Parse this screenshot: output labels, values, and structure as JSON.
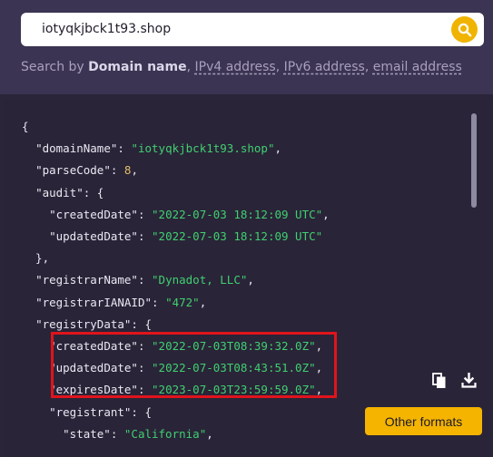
{
  "search": {
    "value": "iotyqkjbck1t93.shop"
  },
  "hint": {
    "prefix": "Search by ",
    "domain_name": "Domain name",
    "sep1": ", ",
    "ipv4": "IPv4 address",
    "sep2": ", ",
    "ipv6": "IPv6 address",
    "sep3": ", ",
    "email": "email address"
  },
  "code_lines": [
    [
      {
        "t": "p",
        "v": "{"
      }
    ],
    [
      {
        "t": "p",
        "v": "  "
      },
      {
        "t": "k",
        "v": "\"domainName\""
      },
      {
        "t": "p",
        "v": ": "
      },
      {
        "t": "s",
        "v": "\"iotyqkjbck1t93.shop\""
      },
      {
        "t": "p",
        "v": ","
      }
    ],
    [
      {
        "t": "p",
        "v": "  "
      },
      {
        "t": "k",
        "v": "\"parseCode\""
      },
      {
        "t": "p",
        "v": ": "
      },
      {
        "t": "n",
        "v": "8"
      },
      {
        "t": "p",
        "v": ","
      }
    ],
    [
      {
        "t": "p",
        "v": "  "
      },
      {
        "t": "k",
        "v": "\"audit\""
      },
      {
        "t": "p",
        "v": ": {"
      }
    ],
    [
      {
        "t": "p",
        "v": "    "
      },
      {
        "t": "k",
        "v": "\"createdDate\""
      },
      {
        "t": "p",
        "v": ": "
      },
      {
        "t": "s",
        "v": "\"2022-07-03 18:12:09 UTC\""
      },
      {
        "t": "p",
        "v": ","
      }
    ],
    [
      {
        "t": "p",
        "v": "    "
      },
      {
        "t": "k",
        "v": "\"updatedDate\""
      },
      {
        "t": "p",
        "v": ": "
      },
      {
        "t": "s",
        "v": "\"2022-07-03 18:12:09 UTC\""
      }
    ],
    [
      {
        "t": "p",
        "v": "  },"
      }
    ],
    [
      {
        "t": "p",
        "v": "  "
      },
      {
        "t": "k",
        "v": "\"registrarName\""
      },
      {
        "t": "p",
        "v": ": "
      },
      {
        "t": "s",
        "v": "\"Dynadot, LLC\""
      },
      {
        "t": "p",
        "v": ","
      }
    ],
    [
      {
        "t": "p",
        "v": "  "
      },
      {
        "t": "k",
        "v": "\"registrarIANAID\""
      },
      {
        "t": "p",
        "v": ": "
      },
      {
        "t": "s",
        "v": "\"472\""
      },
      {
        "t": "p",
        "v": ","
      }
    ],
    [
      {
        "t": "p",
        "v": "  "
      },
      {
        "t": "k",
        "v": "\"registryData\""
      },
      {
        "t": "p",
        "v": ": {"
      }
    ],
    [
      {
        "t": "p",
        "v": "    "
      },
      {
        "t": "k",
        "v": "\"createdDate\""
      },
      {
        "t": "p",
        "v": ": "
      },
      {
        "t": "s",
        "v": "\"2022-07-03T08:39:32.0Z\""
      },
      {
        "t": "p",
        "v": ","
      }
    ],
    [
      {
        "t": "p",
        "v": "    "
      },
      {
        "t": "k",
        "v": "\"updatedDate\""
      },
      {
        "t": "p",
        "v": ": "
      },
      {
        "t": "s",
        "v": "\"2022-07-03T08:43:51.0Z\""
      },
      {
        "t": "p",
        "v": ","
      }
    ],
    [
      {
        "t": "p",
        "v": "    "
      },
      {
        "t": "k",
        "v": "\"expiresDate\""
      },
      {
        "t": "p",
        "v": ": "
      },
      {
        "t": "s",
        "v": "\"2023-07-03T23:59:59.0Z\""
      },
      {
        "t": "p",
        "v": ","
      }
    ],
    [
      {
        "t": "p",
        "v": "    "
      },
      {
        "t": "k",
        "v": "\"registrant\""
      },
      {
        "t": "p",
        "v": ": {"
      }
    ],
    [
      {
        "t": "p",
        "v": "      "
      },
      {
        "t": "k",
        "v": "\"state\""
      },
      {
        "t": "p",
        "v": ": "
      },
      {
        "t": "s",
        "v": "\"California\""
      },
      {
        "t": "p",
        "v": ","
      }
    ]
  ],
  "buttons": {
    "other_formats": "Other formats"
  },
  "icons": {
    "search": "search-icon",
    "copy": "copy-icon",
    "download": "download-icon"
  },
  "colors": {
    "accent": "#f4b400",
    "highlight_border": "#e0141b",
    "string": "#3fd070",
    "number": "#e0bd6a"
  }
}
